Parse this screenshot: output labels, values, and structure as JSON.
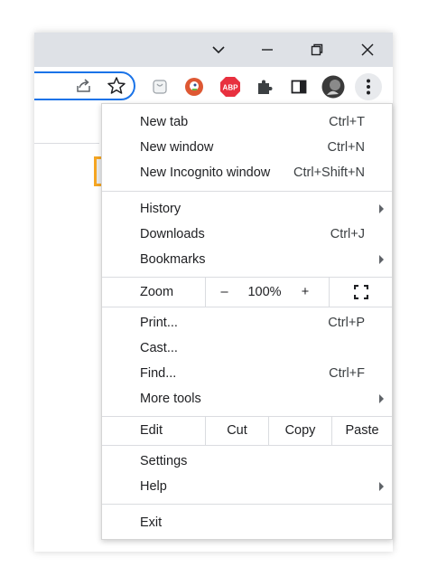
{
  "menu": {
    "new_tab": {
      "label": "New tab",
      "shortcut": "Ctrl+T"
    },
    "new_window": {
      "label": "New window",
      "shortcut": "Ctrl+N"
    },
    "new_incognito": {
      "label": "New Incognito window",
      "shortcut": "Ctrl+Shift+N"
    },
    "history": {
      "label": "History"
    },
    "downloads": {
      "label": "Downloads",
      "shortcut": "Ctrl+J"
    },
    "bookmarks": {
      "label": "Bookmarks"
    },
    "zoom": {
      "label": "Zoom",
      "minus": "–",
      "value": "100%",
      "plus": "+"
    },
    "print": {
      "label": "Print...",
      "shortcut": "Ctrl+P"
    },
    "cast": {
      "label": "Cast..."
    },
    "find": {
      "label": "Find...",
      "shortcut": "Ctrl+F"
    },
    "more_tools": {
      "label": "More tools"
    },
    "edit": {
      "label": "Edit",
      "cut": "Cut",
      "copy": "Copy",
      "paste": "Paste"
    },
    "settings": {
      "label": "Settings"
    },
    "help": {
      "label": "Help"
    },
    "exit": {
      "label": "Exit"
    }
  },
  "toolbar": {
    "extensions": [
      "page-icon",
      "duckduckgo-icon",
      "adblock-plus-icon",
      "puzzle-icon",
      "side-panel-icon",
      "profile-avatar",
      "kebab-menu-icon"
    ],
    "abp_text": "ABP"
  },
  "colors": {
    "highlight": "#f5a623",
    "accent": "#1a73e8"
  }
}
